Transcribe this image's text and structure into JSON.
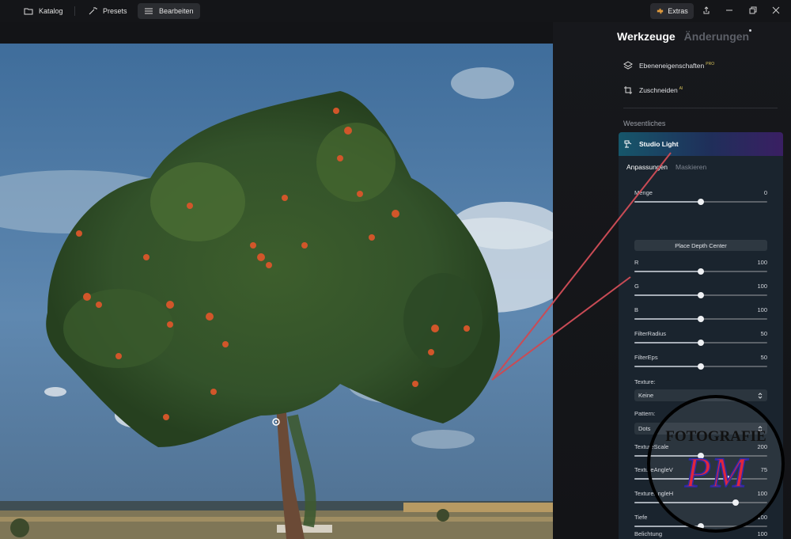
{
  "topbar": {
    "katalog": "Katalog",
    "presets": "Presets",
    "bearbeiten": "Bearbeiten",
    "extras": "Extras"
  },
  "panel": {
    "tab_tools": "Werkzeuge",
    "tab_changes": "Änderungen",
    "layer_properties": "Ebeneneigenschaften",
    "layer_properties_badge": "PRO",
    "crop": "Zuschneiden",
    "crop_badge": "AI",
    "section_essentials": "Wesentliches",
    "studio_light": "Studio Light",
    "subtab_adjustments": "Anpassungen",
    "subtab_masking": "Maskieren",
    "place_depth_center": "Place Depth Center",
    "texture_label": "Texture:",
    "texture_value": "Keine",
    "pattern_label": "Pattern:",
    "pattern_value": "Dots"
  },
  "sliders": [
    {
      "label": "Menge",
      "value": "0",
      "fraction": 0.5
    },
    {
      "label": "R",
      "value": "100",
      "fraction": 0.5
    },
    {
      "label": "G",
      "value": "100",
      "fraction": 0.5
    },
    {
      "label": "B",
      "value": "100",
      "fraction": 0.5
    },
    {
      "label": "FilterRadius",
      "value": "50",
      "fraction": 0.5
    },
    {
      "label": "FilterEps",
      "value": "50",
      "fraction": 0.5
    },
    {
      "label": "TextureScale",
      "value": "200",
      "fraction": 0.5
    },
    {
      "label": "TextureAngleV",
      "value": "75",
      "fraction": 0.7
    },
    {
      "label": "TextureAngleH",
      "value": "100",
      "fraction": 0.76
    },
    {
      "label": "Tiefe",
      "value": "100",
      "fraction": 0.5
    },
    {
      "label": "Belichtung",
      "value": "100",
      "fraction": 0.5
    }
  ],
  "watermark": {
    "line1": "FOTOGRAFIE",
    "initials": "PM"
  },
  "colors": {
    "accent_start": "#16566a",
    "accent_end": "#3a1f63",
    "annotation_line": "#c94b55"
  }
}
